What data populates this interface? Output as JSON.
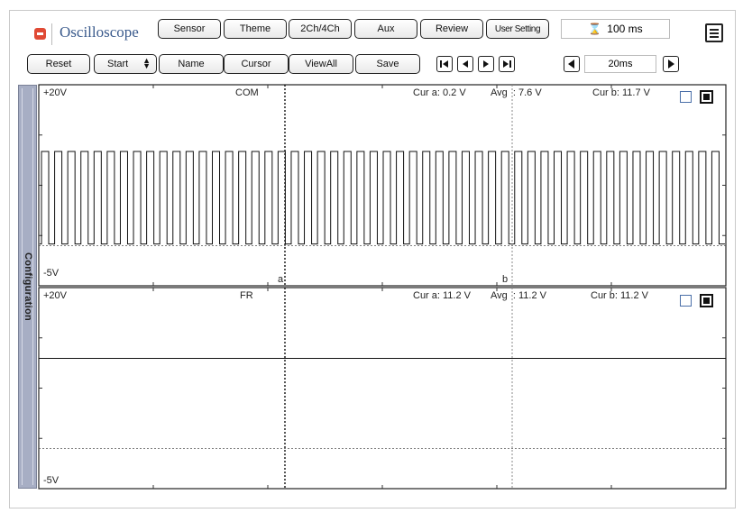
{
  "app": {
    "title": "Oscilloscope"
  },
  "toolbar_top": {
    "sensor": "Sensor",
    "theme": "Theme",
    "channels": "2Ch/4Ch",
    "aux": "Aux",
    "review": "Review",
    "user_setting": "User Setting",
    "timebase": "100 ms"
  },
  "toolbar_bottom": {
    "reset": "Reset",
    "start": "Start",
    "name": "Name",
    "cursor": "Cursor",
    "view_all": "ViewAll",
    "save": "Save",
    "zoom": "20ms"
  },
  "icons": {
    "app": "app-icon",
    "timebase": "hourglass-icon",
    "menu": "menu-icon",
    "start_select": "updown-chevron-icon",
    "nav": [
      "skip-first-icon",
      "prev-icon",
      "next-icon",
      "skip-last-icon"
    ],
    "zoom": [
      "zoom-out-arrow-icon",
      "zoom-in-arrow-icon"
    ]
  },
  "sidebar": {
    "label": "Configuration"
  },
  "channels": [
    {
      "name": "COM",
      "ymax_label": "+20V",
      "ymin_label": "-5V",
      "cur_a": "Cur a: 0.2 V",
      "avg": "Avg  : 7.6 V",
      "cur_b": "Cur b: 11.7 V",
      "cursor_a_label": "a",
      "cursor_b_label": "b",
      "high_v": 11.7,
      "low_v": 0.2,
      "pulse_count": 52
    },
    {
      "name": "FR",
      "ymax_label": "+20V",
      "ymin_label": "-5V",
      "cur_a": "Cur a: 11.2 V",
      "avg": "Avg  : 11.2 V",
      "cur_b": "Cur b: 11.2 V",
      "level_v": 11.2
    }
  ],
  "colors": {
    "title": "#3a5a8c",
    "sidebar": "#a7aec4",
    "app_icon": "#e04a35",
    "checkbox_border": "#4a6fa8"
  }
}
